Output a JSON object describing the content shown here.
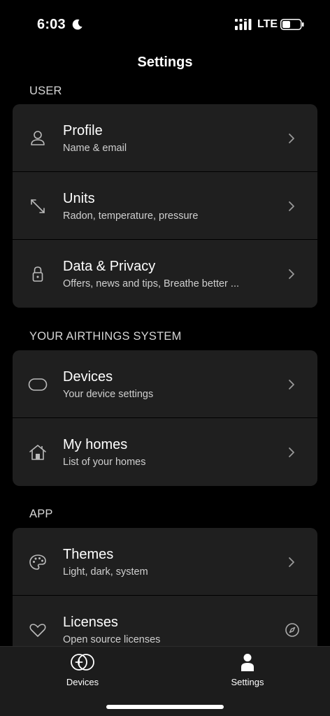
{
  "status_bar": {
    "time": "6:03",
    "network": "LTE"
  },
  "header": {
    "title": "Settings"
  },
  "sections": {
    "user": {
      "label": "USER",
      "items": [
        {
          "title": "Profile",
          "subtitle": "Name & email",
          "icon": "person-icon"
        },
        {
          "title": "Units",
          "subtitle": "Radon, temperature, pressure",
          "icon": "expand-arrows-icon"
        },
        {
          "title": "Data & Privacy",
          "subtitle": "Offers, news and tips, Breathe better ...",
          "icon": "lock-icon"
        }
      ]
    },
    "system": {
      "label": "YOUR AIRTHINGS SYSTEM",
      "items": [
        {
          "title": "Devices",
          "subtitle": "Your device settings",
          "icon": "device-icon"
        },
        {
          "title": "My homes",
          "subtitle": "List of your homes",
          "icon": "house-icon"
        }
      ]
    },
    "app": {
      "label": "APP",
      "items": [
        {
          "title": "Themes",
          "subtitle": "Light, dark, system",
          "icon": "palette-icon"
        },
        {
          "title": "Licenses",
          "subtitle": "Open source licenses",
          "icon": "heart-icon"
        }
      ]
    }
  },
  "tab_bar": {
    "tabs": [
      {
        "label": "Devices",
        "icon": "add-device-icon"
      },
      {
        "label": "Settings",
        "icon": "user-icon"
      }
    ]
  },
  "colors": {
    "background": "#000000",
    "card": "#1f1f1f",
    "tab_bar": "#1c1c1c",
    "text": "#ffffff",
    "subtext": "#cfcfcf"
  }
}
